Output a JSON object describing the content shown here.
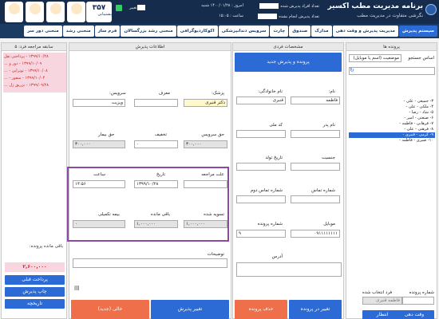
{
  "header": {
    "title": "برنامه مدیریت مطب اکسیر",
    "subtitle": "نگرشی متفاوت در مدیریت مطب",
    "reception_count_label": "تعداد افراد پذیرش شده",
    "waiting_count_label": "تعداد پذیرش انجام نشده",
    "today_label": "امروز :",
    "today_date": "۱۴۰۰/۰۱/۲۸ شنبه",
    "time_label": "ساعت :",
    "time_value": "۱۵:۰۵",
    "change_label": "تغییر",
    "counter_number": "۳۵۷",
    "counter_label": "پشتیبانی",
    "icons": [
      {
        "name": "support-icon",
        "cap": ""
      },
      {
        "name": "doctor-icon",
        "cap": ""
      },
      {
        "name": "secretary-icon",
        "cap": ""
      },
      {
        "name": "users-icon",
        "cap": ""
      }
    ]
  },
  "tabs": [
    {
      "label": "سیستم پذیرش",
      "active": true
    },
    {
      "label": "مدیریت پذیرش و وقت دهی",
      "active": false
    },
    {
      "label": "مدارک",
      "active": false
    },
    {
      "label": "صندوق",
      "active": false
    },
    {
      "label": "چارت",
      "active": false
    },
    {
      "label": "سرویس دندانپزشکی",
      "active": false
    },
    {
      "label": "اکوکاردیوگرافی",
      "active": false
    },
    {
      "label": "منحنی رشد بزرگسالان",
      "active": false
    },
    {
      "label": "فرم ساز",
      "active": false
    },
    {
      "label": "منحنی رشد",
      "active": false
    },
    {
      "label": "منحنی دور سر",
      "active": false
    }
  ],
  "patients": {
    "title": "پرونده ها",
    "search_label": "اساس جستجو",
    "search_by": "موضعیت (اسم یا موبایل)",
    "tree": [
      "۳- جمیعی - علی -",
      "۴- ملکی - علی -",
      "۵- شاد - رضا -",
      "۶- صنعتی - امیر -",
      "۷- فرهانی - فاطمه -",
      "۸- فرهنی - علی -",
      "۹- کرمی - قنبری -",
      "۱۰- صیری - فاطمه -"
    ],
    "selected_index": 6,
    "file_number_label": "شماره پرونده",
    "turn_label": "فرد انتخاب شده",
    "turn_value": "فاطمه قنبری",
    "btn_new_visit": "وقت دهی",
    "btn_waiting": "انتظار"
  },
  "personal": {
    "title": "مشخصات فردی",
    "btn_new": "پرونده و پذیرش جدید",
    "first_name_label": "نام:",
    "first_name": "فاطمه",
    "last_name_label": "نام خانوادگی:",
    "last_name": "قنبری",
    "father_label": "نام پدر",
    "national_label": "کد ملی",
    "gender_label": "جنسیت",
    "birth_label": "تاریخ تولد",
    "phone_label": "شماره تماس",
    "phone2_label": "شماره تماس دوم",
    "mobile_label": "موبایل",
    "mobile": "۰۹۱۱۱۱۱۱۱۱",
    "file_label": "شماره پرونده",
    "file_value": "۹",
    "address_label": "آدرس",
    "btn_change_file": "تغییر در پرونده",
    "btn_delete_file": "حذف پرونده"
  },
  "reception": {
    "title": "اطلاعات پذیرش",
    "doctor_label": "پزشک:",
    "doctor": "دکتر قنبری",
    "referrer_label": "معرف",
    "service_label": "سرویس:",
    "service": "ویزیت",
    "service_fee_label": "حق سرویس",
    "service_fee": "۳۰۰,۰۰۰",
    "discount_label": "تخفیف",
    "discount": "۰",
    "patient_fee_label": "حق بیمار",
    "patient_fee": "۳۰۰,۰۰۰",
    "reason_label": "علت مراجعه",
    "date_label": "تاریخ",
    "date": "۱۳۹۹/۱۰/۲۸",
    "time_label": "ساعت",
    "time": "۱۴:۵۶",
    "paid_label": "تسویه شده",
    "paid": "۱,۰۰۰,۰۰۰",
    "remain_label": "باقی مانده",
    "remain": "۱,۰۰۰,۰۰۰",
    "insurance_label": "بیمه تکمیلی",
    "insurance": "۰",
    "notes_label": "توضیحات",
    "btn_change": "تغییر پذیرش",
    "btn_empty": "خالی (جدید)"
  },
  "history": {
    "title": "سابقه مراجعه فرد: ۵",
    "items": [
      "۱۳۹۹/۱۰/۲۸ - پرداختی نقل",
      "۱۳۹۹/۱۰/۰۹ - دور و ...",
      "۱۳۹۹/۱۰/۰۸ - توتراپی - ...",
      "۱۳۹۹/۱۰/۰۴ - منفور - ...",
      "۱۳۹۹/۰۹/۲۸ - تزریق ژل ..."
    ],
    "remain_label": "باقی مانده پرونده:",
    "remain_value": "۲,۶۰۰,۰۰۰",
    "btn_pay": "پرداخت قبلی",
    "btn_print": "چاپ پذیرش",
    "btn_history": "تاریخچه"
  }
}
